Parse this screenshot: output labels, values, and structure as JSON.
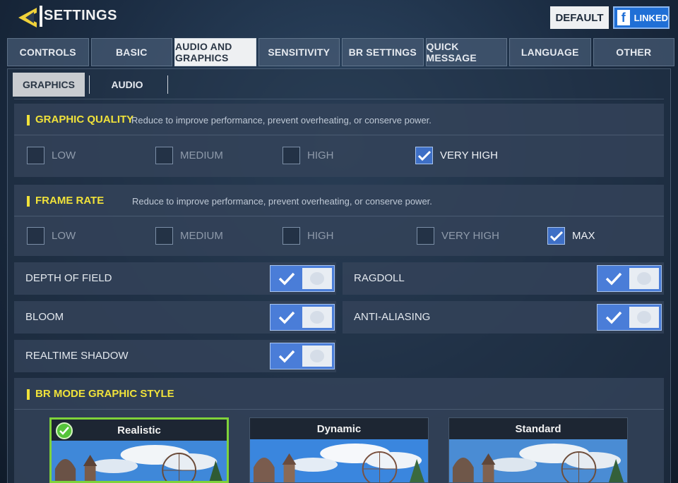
{
  "header": {
    "title": "SETTINGS",
    "default_label": "DEFAULT",
    "linked_label": "LINKED",
    "fb_glyph": "f"
  },
  "tabs": [
    {
      "label": "CONTROLS",
      "active": false
    },
    {
      "label": "BASIC",
      "active": false
    },
    {
      "label": "AUDIO AND GRAPHICS",
      "active": true
    },
    {
      "label": "SENSITIVITY",
      "active": false
    },
    {
      "label": "BR SETTINGS",
      "active": false
    },
    {
      "label": "QUICK MESSAGE",
      "active": false
    },
    {
      "label": "LANGUAGE",
      "active": false
    },
    {
      "label": "OTHER",
      "active": false
    }
  ],
  "subtabs": [
    {
      "label": "GRAPHICS",
      "active": true
    },
    {
      "label": "AUDIO",
      "active": false
    }
  ],
  "graphic_quality": {
    "title": "GRAPHIC QUALITY",
    "description": "Reduce to improve performance, prevent overheating, or conserve power.",
    "options": [
      {
        "label": "LOW",
        "checked": false
      },
      {
        "label": "MEDIUM",
        "checked": false
      },
      {
        "label": "HIGH",
        "checked": false
      },
      {
        "label": "VERY HIGH",
        "checked": true
      }
    ]
  },
  "frame_rate": {
    "title": "FRAME RATE",
    "description": "Reduce to improve performance, prevent overheating, or conserve power.",
    "options": [
      {
        "label": "LOW",
        "checked": false
      },
      {
        "label": "MEDIUM",
        "checked": false
      },
      {
        "label": "HIGH",
        "checked": false
      },
      {
        "label": "VERY HIGH",
        "checked": false
      },
      {
        "label": "MAX",
        "checked": true
      }
    ]
  },
  "toggles": {
    "depth_of_field": {
      "label": "DEPTH OF FIELD",
      "on": true
    },
    "ragdoll": {
      "label": "RAGDOLL",
      "on": true
    },
    "bloom": {
      "label": "BLOOM",
      "on": true
    },
    "anti_aliasing": {
      "label": "ANTI-ALIASING",
      "on": true
    },
    "realtime_shadow": {
      "label": "REALTIME SHADOW",
      "on": true
    }
  },
  "br_style": {
    "title": "BR MODE GRAPHIC STYLE",
    "styles": [
      {
        "label": "Realistic",
        "selected": true
      },
      {
        "label": "Dynamic",
        "selected": false
      },
      {
        "label": "Standard",
        "selected": false
      }
    ]
  },
  "colors": {
    "accent_yellow": "#f0e23a",
    "toggle_blue": "#4a7dd8",
    "select_green": "#7fd33a",
    "fb_blue": "#1f6fd6"
  },
  "icons": {
    "back": "back-chevron-icon",
    "check": "checkmark-icon",
    "facebook": "facebook-icon"
  }
}
